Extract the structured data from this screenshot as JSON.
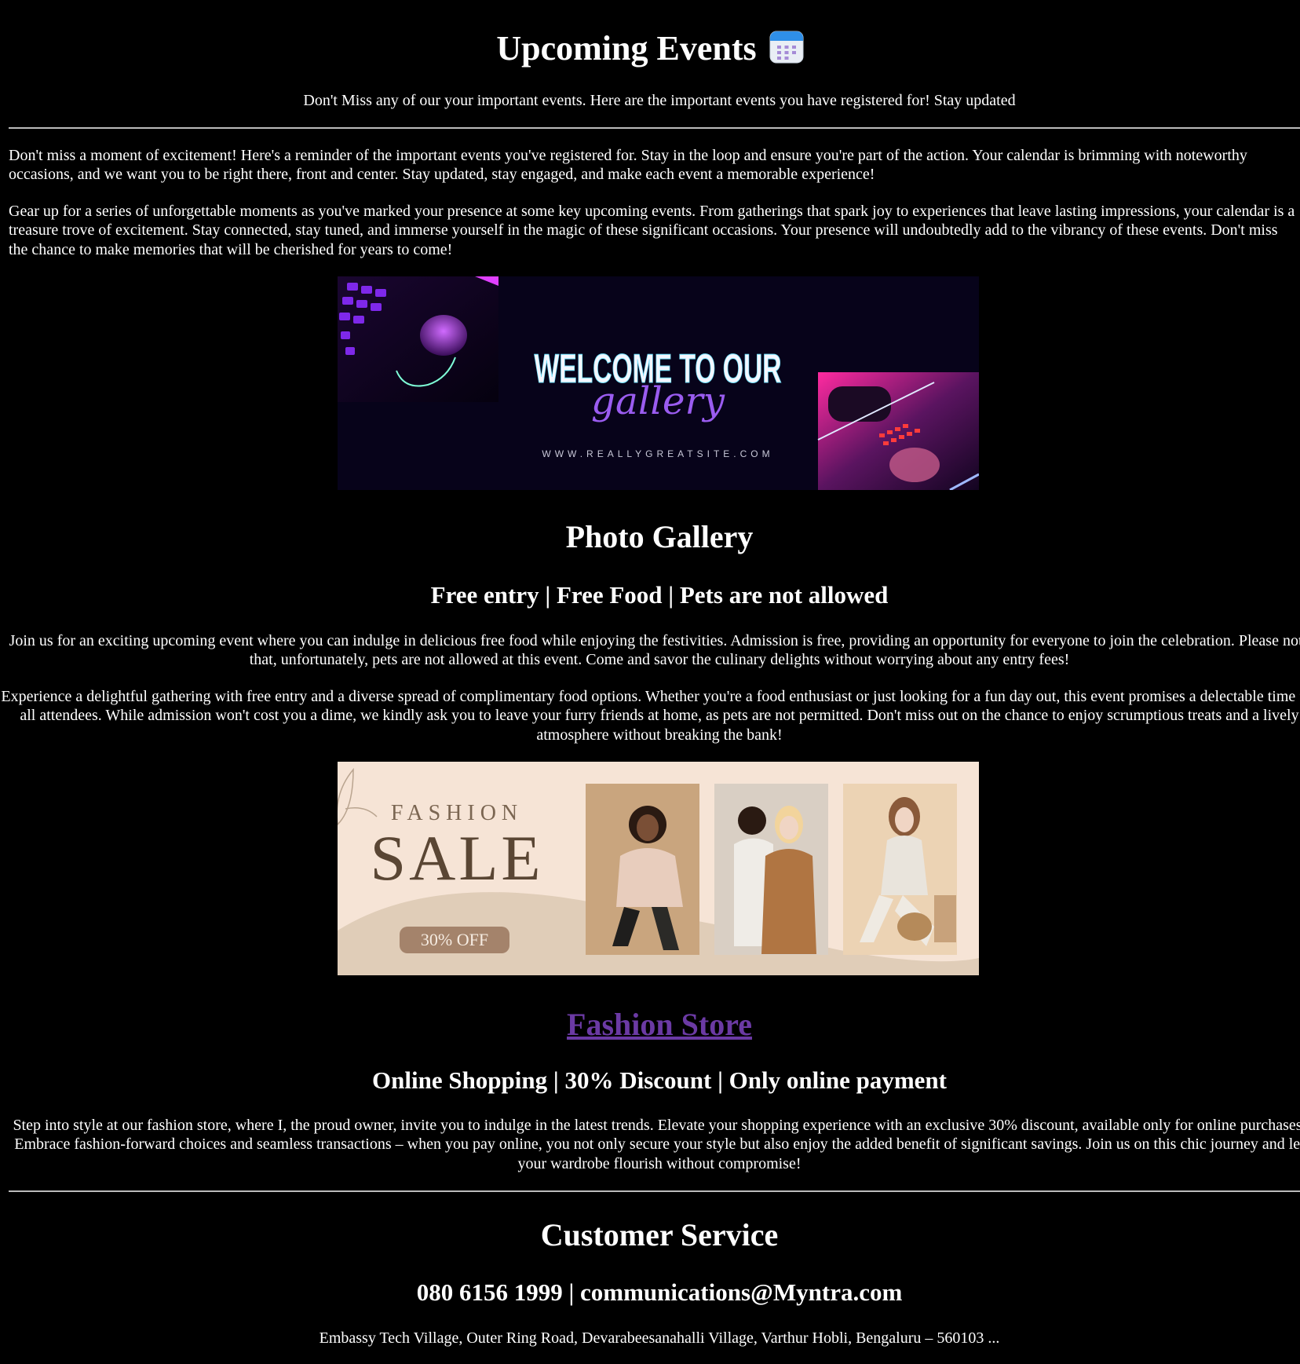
{
  "header": {
    "title": "Upcoming Events",
    "subtitle": "Don't Miss any of our your important events. Here are the important events you have registered for! Stay updated"
  },
  "intro": {
    "paragraph_1": "Don't miss a moment of excitement! Here's a reminder of the important events you've registered for. Stay in the loop and ensure you're part of the action. Your calendar is brimming with noteworthy occasions, and we want you to be right there, front and center. Stay updated, stay engaged, and make each event a memorable experience!",
    "paragraph_2": "Gear up for a series of unforgettable moments as you've marked your presence at some key upcoming events. From gatherings that spark joy to experiences that leave lasting impressions, your calendar is a treasure trove of excitement. Stay connected, stay tuned, and immerse yourself in the magic of these significant occasions. Your presence will undoubtedly add to the vibrancy of these events. Don't miss the chance to make memories that will be cherished for years to come!"
  },
  "gallery_banner": {
    "headline": "WELCOME TO OUR",
    "script": "gallery",
    "url": "WWW.REALLYGREATSITE.COM"
  },
  "gallery": {
    "heading": "Photo Gallery",
    "tagline": "Free entry | Free Food | Pets are not allowed",
    "paragraph_1": "Join us for an exciting upcoming event where you can indulge in delicious free food while enjoying the festivities. Admission is free, providing an opportunity for everyone to join the celebration. Please note that, unfortunately, pets are not allowed at this event. Come and savor the culinary delights without worrying about any entry fees!",
    "paragraph_2": "Experience a delightful gathering with free entry and a diverse spread of complimentary food options. Whether you're a food enthusiast or just looking for a fun day out, this event promises a delectable time for all attendees. While admission won't cost you a dime, we kindly ask you to leave your furry friends at home, as pets are not permitted. Don't miss out on the chance to enjoy scrumptious treats and a lively atmosphere without breaking the bank!"
  },
  "fashion_banner": {
    "kicker": "FASHION",
    "headline": "SALE",
    "badge": "30% OFF"
  },
  "store": {
    "link_label": "Fashion Store",
    "tagline": "Online Shopping | 30% Discount | Only online payment",
    "paragraph": "Step into style at our fashion store, where I, the proud owner, invite you to indulge in the latest trends. Elevate your shopping experience with an exclusive 30% discount, available only for online purchases. Embrace fashion-forward choices and seamless transactions – when you pay online, you not only secure your style but also enjoy the added benefit of significant savings. Join us on this chic journey and let your wardrobe flourish without compromise!"
  },
  "service": {
    "heading": "Customer Service",
    "contact": "080 6156 1999 | communications@Myntra.com",
    "address": "Embassy Tech Village, Outer Ring Road, Devarabeesanahalli Village, Varthur Hobli, Bengaluru – 560103 ..."
  },
  "colors": {
    "background": "#000000",
    "text": "#ffffff",
    "link": "#6b3aa4",
    "gallery_bg": "#07031a",
    "neon_purple": "#a14cff",
    "fashion_bg": "#f6e4d6",
    "fashion_text": "#6e5a48",
    "badge_bg": "#a4836b"
  }
}
